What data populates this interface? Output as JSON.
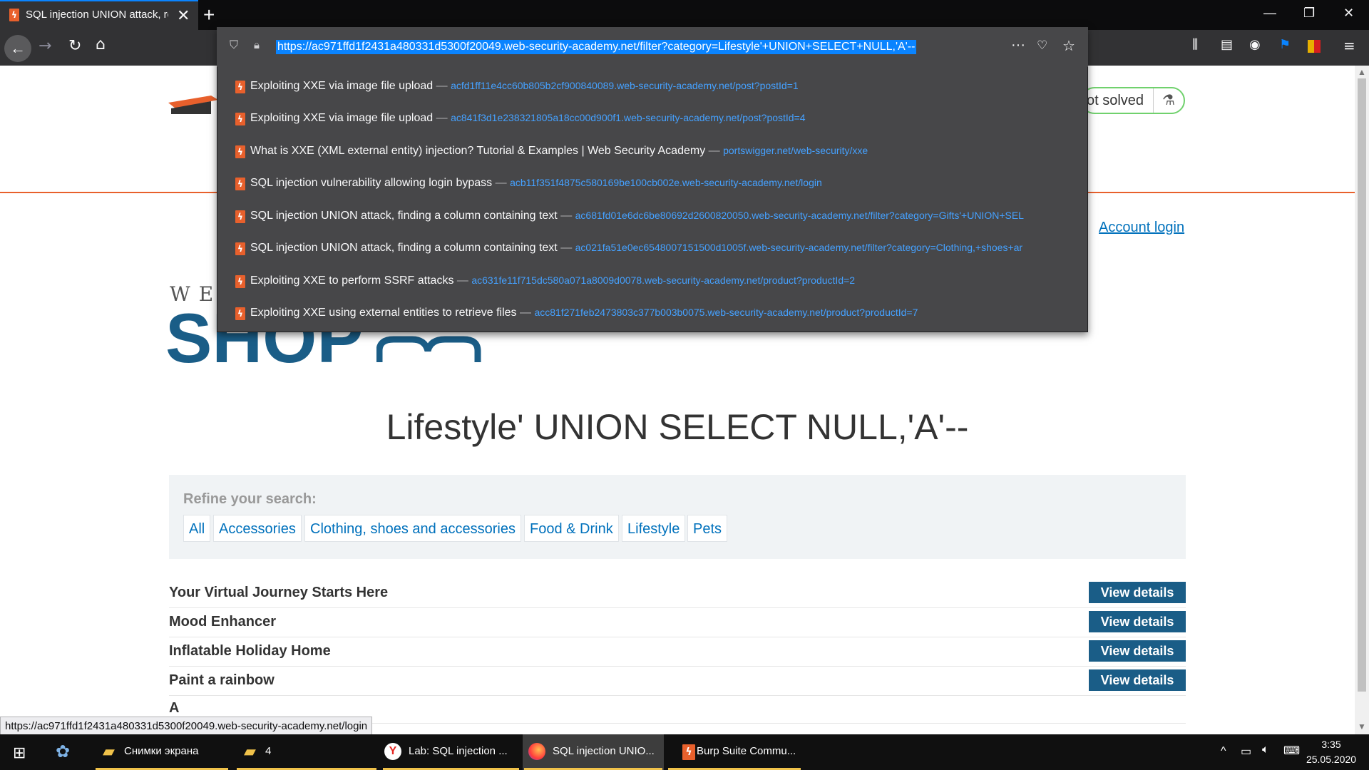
{
  "browser": {
    "tab_title": "SQL injection UNION attack, re",
    "url": "https://ac971ffd1f2431a480331d5300f20049.web-security-academy.net/filter?category=Lifestyle'+UNION+SELECT+NULL,'A'--",
    "status_url": "https://ac971ffd1f2431a480331d5300f20049.web-security-academy.net/login",
    "suggestions": [
      {
        "title": "Exploiting XXE via image file upload",
        "url": "acfd1ff11e4cc60b805b2cf900840089.web-security-academy.net/post?postId=1"
      },
      {
        "title": "Exploiting XXE via image file upload",
        "url": "ac841f3d1e238321805a18cc00d900f1.web-security-academy.net/post?postId=4"
      },
      {
        "title": "What is XXE (XML external entity) injection? Tutorial & Examples | Web Security Academy",
        "url": "portswigger.net/web-security/xxe"
      },
      {
        "title": "SQL injection vulnerability allowing login bypass",
        "url": "acb11f351f4875c580169be100cb002e.web-security-academy.net/login"
      },
      {
        "title": "SQL injection UNION attack, finding a column containing text",
        "url": "ac681fd01e6dc6be80692d2600820050.web-security-academy.net/filter?category=Gifts'+UNION+SEL"
      },
      {
        "title": "SQL injection UNION attack, finding a column containing text",
        "url": "ac021fa51e0ec6548007151500d1005f.web-security-academy.net/filter?category=Clothing,+shoes+ar"
      },
      {
        "title": "Exploiting XXE to perform SSRF attacks",
        "url": "ac631fe11f715dc580a071a8009d0078.web-security-academy.net/product?productId=2"
      },
      {
        "title": "Exploiting XXE using external entities to retrieve files",
        "url": "acc81f271feb2473803c377b003b0075.web-security-academy.net/product?productId=7"
      }
    ]
  },
  "page": {
    "lab_status": "ot solved",
    "account_login": "Account login",
    "logo_we": "WE",
    "logo_shop": "SHOP",
    "title": "Lifestyle' UNION SELECT NULL,'A'--",
    "refine_label": "Refine your search:",
    "filters": [
      "All",
      "Accessories",
      "Clothing, shoes and accessories",
      "Food & Drink",
      "Lifestyle",
      "Pets"
    ],
    "products": [
      {
        "name": "Your Virtual Journey Starts Here",
        "button": "View details"
      },
      {
        "name": "Mood Enhancer",
        "button": "View details"
      },
      {
        "name": "Inflatable Holiday Home",
        "button": "View details"
      },
      {
        "name": "Paint a rainbow",
        "button": "View details"
      },
      {
        "name": "A",
        "button": ""
      }
    ]
  },
  "taskbar": {
    "items": [
      "Снимки экрана",
      "4",
      "Lab: SQL injection ...",
      "SQL injection UNIO...",
      "Burp Suite Commu..."
    ],
    "time": "3:35",
    "date": "25.05.2020"
  },
  "colors": {
    "accent": "#0a84ff",
    "brand_orange": "#e8602c",
    "shop_blue": "#1a5d87",
    "link_blue": "#0071bc",
    "solved_green": "#70d16d"
  }
}
